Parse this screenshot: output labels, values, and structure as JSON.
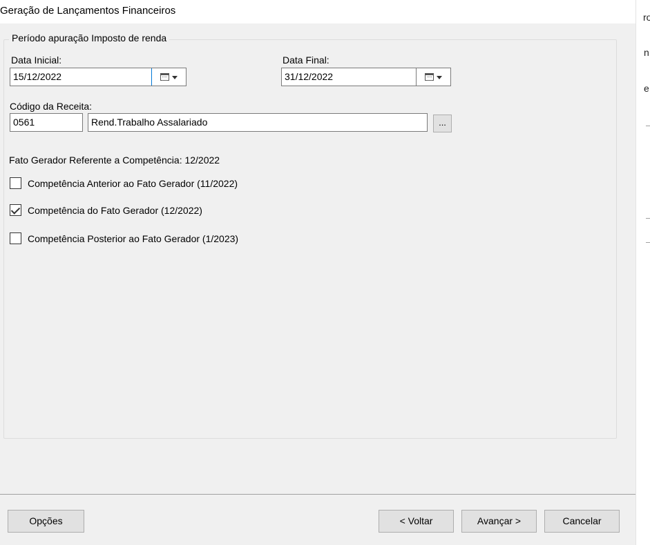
{
  "window": {
    "title": "Geração de Lançamentos Financeiros"
  },
  "right_strip": {
    "chars": [
      "ro",
      "n",
      "e"
    ]
  },
  "period": {
    "legend": "Período apuração Imposto de renda",
    "start_label": "Data Inicial:",
    "start_value": "15/12/2022",
    "end_label": "Data Final:",
    "end_value": "31/12/2022"
  },
  "revenue": {
    "label": "Código da Receita:",
    "code": "0561",
    "description": "Rend.Trabalho Assalariado",
    "lookup_label": "..."
  },
  "fact": {
    "heading": "Fato Gerador Referente a Competência: 12/2022",
    "options": [
      {
        "label": "Competência Anterior ao Fato Gerador (11/2022)",
        "checked": false
      },
      {
        "label": "Competência do Fato Gerador (12/2022)",
        "checked": true
      },
      {
        "label": "Competência Posterior ao Fato Gerador (1/2023)",
        "checked": false
      }
    ]
  },
  "buttons": {
    "options": "Opções",
    "back": "< Voltar",
    "next": "Avançar >",
    "cancel": "Cancelar"
  }
}
